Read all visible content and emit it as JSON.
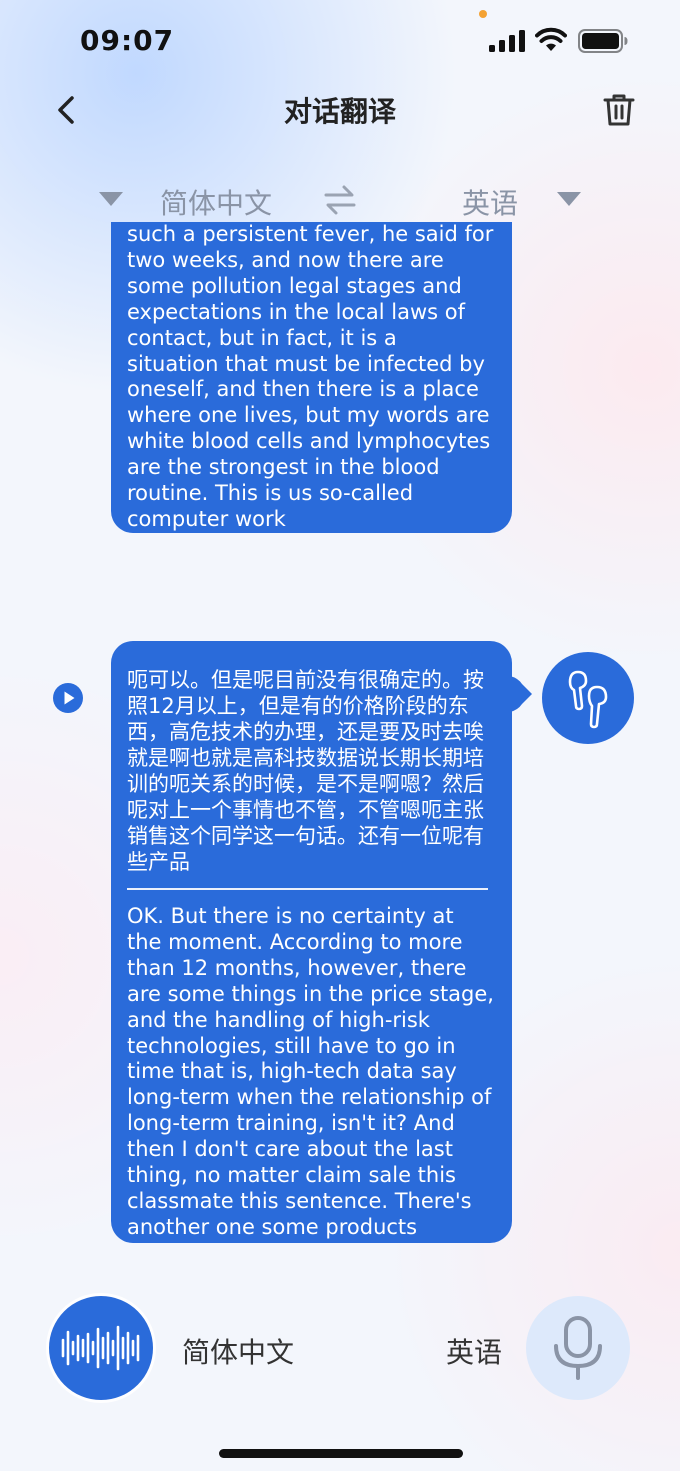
{
  "status_bar": {
    "time": "09:07"
  },
  "header": {
    "title": "对话翻译"
  },
  "language_bar": {
    "source": "简体中文",
    "target": "英语"
  },
  "messages": {
    "first_translation": "such a persistent fever, he said for two weeks, and now there are some pollution legal stages and expectations in the local laws of contact, but in fact, it is a situation that must be infected by oneself, and then there is a place where one lives, but my words are white blood cells and lymphocytes are the strongest in the blood routine. This is us so-called computer work",
    "second_source": "呃可以。但是呢目前没有很确定的。按照12月以上，但是有的价格阶段的东西，高危技术的办理，还是要及时去唉就是啊也就是高科技数据说长期长期培训的呃关系的时候，是不是啊嗯？然后呢对上一个事情也不管，不管嗯呃主张销售这个同学这一句话。还有一位呢有些产品",
    "second_translation": " OK. But there is no certainty at the moment. According to more than 12 months, however, there are some things in the price stage, and the handling of high-risk technologies, still have to go in time that is, high-tech data say long-term when the relationship of long-term training, isn't it? And then I don't care about the last thing, no matter claim sale this classmate this sentence. There's another one some products"
  },
  "bottom_bar": {
    "left_language": "简体中文",
    "right_language": "英语"
  },
  "colors": {
    "accent": "#2a6bda",
    "mic_bg": "#dde9fb",
    "muted_text": "#8a94a6"
  }
}
